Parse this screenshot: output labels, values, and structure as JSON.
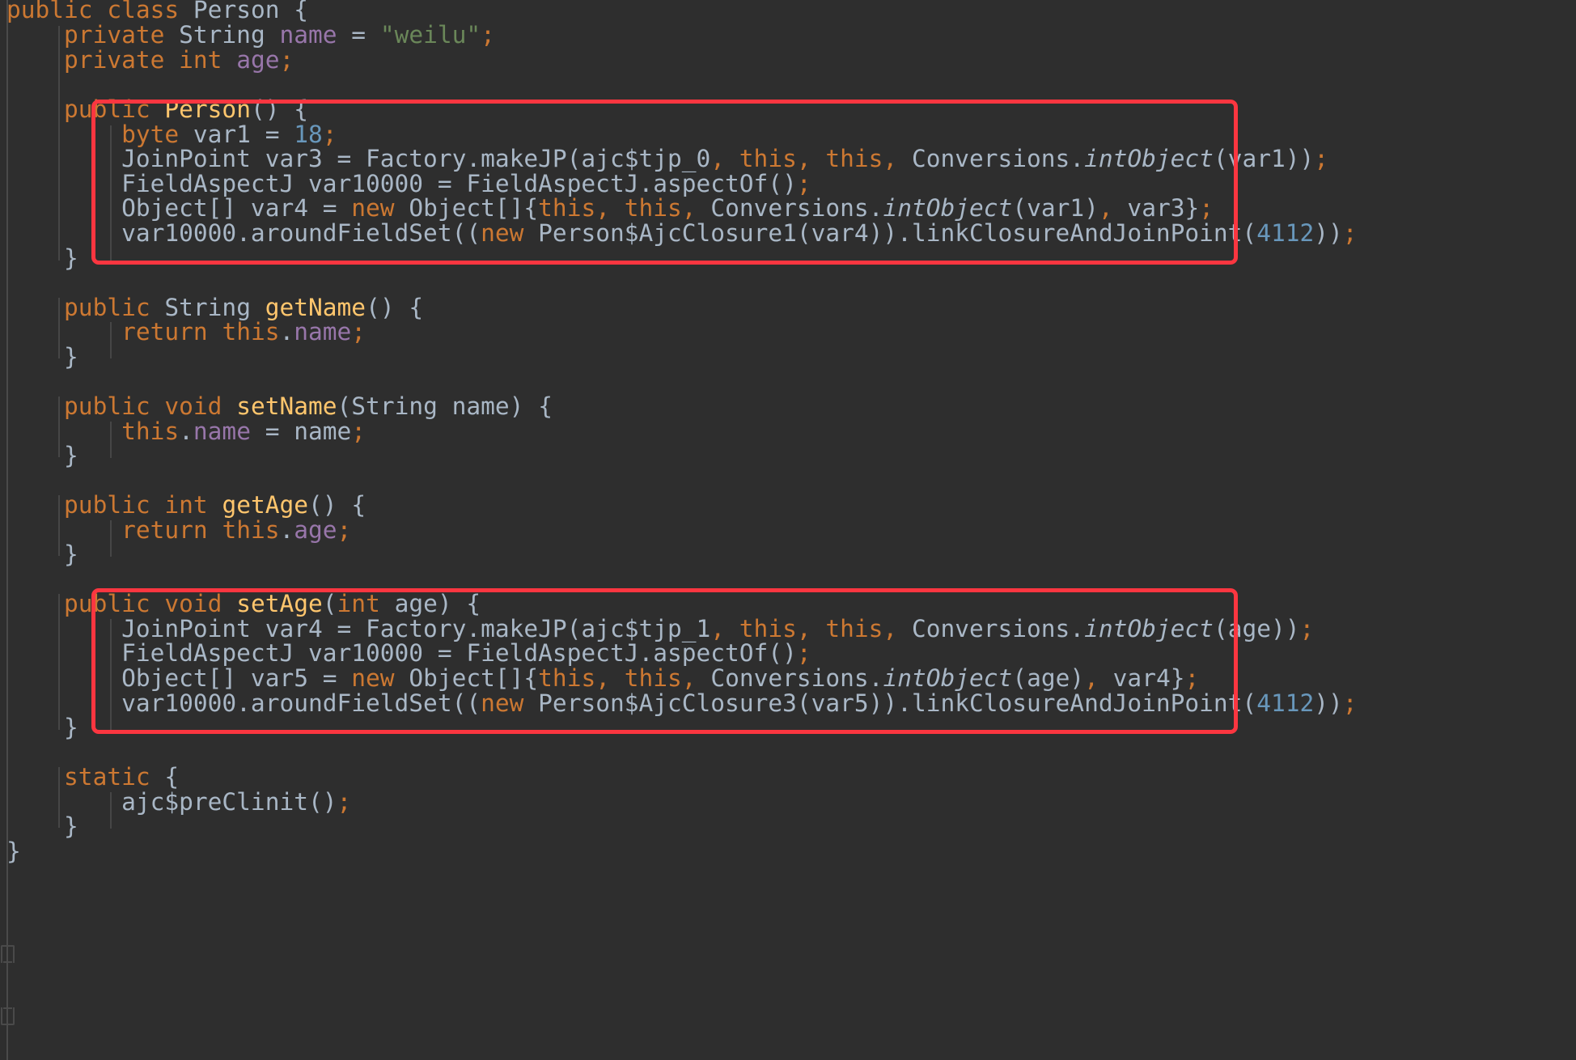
{
  "editor": {
    "language": "java",
    "theme": "darcula",
    "background_color": "#2e2e2e",
    "default_text_color": "#a9b7c6",
    "colors": {
      "keyword": "#cc7832",
      "method_declaration": "#ffc66d",
      "field": "#9876aa",
      "string": "#6a8759",
      "number": "#6897bb",
      "identifier": "#a9b7c6",
      "annotation_box": "#fb3640",
      "indent_guide": "#464646",
      "gutter_line": "#4a4a4a"
    },
    "font_size_px": 29.5,
    "line_height_px": 30.6
  },
  "annotations": {
    "box_1_label": "constructor-weaving-highlight",
    "box_2_label": "setter-weaving-highlight"
  },
  "code_lines": [
    {
      "n": 1,
      "indent": 0,
      "text": "public class Person {"
    },
    {
      "n": 2,
      "indent": 1,
      "text": "private String name = \"weilu\";"
    },
    {
      "n": 3,
      "indent": 1,
      "text": "private int age;"
    },
    {
      "n": 4,
      "indent": 0,
      "text": ""
    },
    {
      "n": 5,
      "indent": 1,
      "text": "public Person() {"
    },
    {
      "n": 6,
      "indent": 2,
      "text": "byte var1 = 18;"
    },
    {
      "n": 7,
      "indent": 2,
      "text": "JoinPoint var3 = Factory.makeJP(ajc$tjp_0, this, this, Conversions.intObject(var1));"
    },
    {
      "n": 8,
      "indent": 2,
      "text": "FieldAspectJ var10000 = FieldAspectJ.aspectOf();"
    },
    {
      "n": 9,
      "indent": 2,
      "text": "Object[] var4 = new Object[]{this, this, Conversions.intObject(var1), var3};"
    },
    {
      "n": 10,
      "indent": 2,
      "text": "var10000.aroundFieldSet((new Person$AjcClosure1(var4)).linkClosureAndJoinPoint(4112));"
    },
    {
      "n": 11,
      "indent": 1,
      "text": "}"
    },
    {
      "n": 12,
      "indent": 0,
      "text": ""
    },
    {
      "n": 13,
      "indent": 1,
      "text": "public String getName() {"
    },
    {
      "n": 14,
      "indent": 2,
      "text": "return this.name;"
    },
    {
      "n": 15,
      "indent": 1,
      "text": "}"
    },
    {
      "n": 16,
      "indent": 0,
      "text": ""
    },
    {
      "n": 17,
      "indent": 1,
      "text": "public void setName(String name) {"
    },
    {
      "n": 18,
      "indent": 2,
      "text": "this.name = name;"
    },
    {
      "n": 19,
      "indent": 1,
      "text": "}"
    },
    {
      "n": 20,
      "indent": 0,
      "text": ""
    },
    {
      "n": 21,
      "indent": 1,
      "text": "public int getAge() {"
    },
    {
      "n": 22,
      "indent": 2,
      "text": "return this.age;"
    },
    {
      "n": 23,
      "indent": 1,
      "text": "}"
    },
    {
      "n": 24,
      "indent": 0,
      "text": ""
    },
    {
      "n": 25,
      "indent": 1,
      "text": "public void setAge(int age) {"
    },
    {
      "n": 26,
      "indent": 2,
      "text": "JoinPoint var4 = Factory.makeJP(ajc$tjp_1, this, this, Conversions.intObject(age));"
    },
    {
      "n": 27,
      "indent": 2,
      "text": "FieldAspectJ var10000 = FieldAspectJ.aspectOf();"
    },
    {
      "n": 28,
      "indent": 2,
      "text": "Object[] var5 = new Object[]{this, this, Conversions.intObject(age), var4};"
    },
    {
      "n": 29,
      "indent": 2,
      "text": "var10000.aroundFieldSet((new Person$AjcClosure3(var5)).linkClosureAndJoinPoint(4112));"
    },
    {
      "n": 30,
      "indent": 1,
      "text": "}"
    },
    {
      "n": 31,
      "indent": 0,
      "text": ""
    },
    {
      "n": 32,
      "indent": 1,
      "text": "static {"
    },
    {
      "n": 33,
      "indent": 2,
      "text": "ajc$preClinit();"
    },
    {
      "n": 34,
      "indent": 1,
      "text": "}"
    },
    {
      "n": 35,
      "indent": 0,
      "text": "}"
    }
  ],
  "tokens": {
    "l1": [
      {
        "t": "public",
        "c": "kw"
      },
      {
        "t": " ",
        "c": "pun"
      },
      {
        "t": "class",
        "c": "kw"
      },
      {
        "t": " ",
        "c": "pun"
      },
      {
        "t": "Person",
        "c": "cls"
      },
      {
        "t": " {",
        "c": "pun"
      }
    ],
    "l2": [
      {
        "t": "    ",
        "c": "pun"
      },
      {
        "t": "private",
        "c": "kw"
      },
      {
        "t": " ",
        "c": "pun"
      },
      {
        "t": "String",
        "c": "cls"
      },
      {
        "t": " ",
        "c": "pun"
      },
      {
        "t": "name",
        "c": "fld"
      },
      {
        "t": " = ",
        "c": "pun"
      },
      {
        "t": "\"weilu\"",
        "c": "str"
      },
      {
        "t": ";",
        "c": "semi"
      }
    ],
    "l3": [
      {
        "t": "    ",
        "c": "pun"
      },
      {
        "t": "private",
        "c": "kw"
      },
      {
        "t": " ",
        "c": "pun"
      },
      {
        "t": "int",
        "c": "kw"
      },
      {
        "t": " ",
        "c": "pun"
      },
      {
        "t": "age",
        "c": "fld"
      },
      {
        "t": ";",
        "c": "semi"
      }
    ],
    "l5": [
      {
        "t": "    ",
        "c": "pun"
      },
      {
        "t": "public",
        "c": "kw"
      },
      {
        "t": " ",
        "c": "pun"
      },
      {
        "t": "Person",
        "c": "mth"
      },
      {
        "t": "() {",
        "c": "pun"
      }
    ],
    "l6": [
      {
        "t": "        ",
        "c": "pun"
      },
      {
        "t": "byte",
        "c": "kw"
      },
      {
        "t": " var1 = ",
        "c": "pun"
      },
      {
        "t": "18",
        "c": "num"
      },
      {
        "t": ";",
        "c": "semi"
      }
    ],
    "l7": [
      {
        "t": "        JoinPoint var3 = Factory.makeJP(ajc$tjp_0",
        "c": "cls"
      },
      {
        "t": ",",
        "c": "semi"
      },
      {
        "t": " ",
        "c": "pun"
      },
      {
        "t": "this",
        "c": "kw"
      },
      {
        "t": ",",
        "c": "semi"
      },
      {
        "t": " ",
        "c": "pun"
      },
      {
        "t": "this",
        "c": "kw"
      },
      {
        "t": ",",
        "c": "semi"
      },
      {
        "t": " ",
        "c": "pun"
      },
      {
        "t": "Conversions.",
        "c": "cls"
      },
      {
        "t": "intObject",
        "c": "stat"
      },
      {
        "t": "(var1))",
        "c": "cls"
      },
      {
        "t": ";",
        "c": "semi"
      }
    ],
    "l8": [
      {
        "t": "        FieldAspectJ var10000 = FieldAspectJ.aspectOf()",
        "c": "cls"
      },
      {
        "t": ";",
        "c": "semi"
      }
    ],
    "l9": [
      {
        "t": "        Object[] var4 = ",
        "c": "cls"
      },
      {
        "t": "new",
        "c": "kw"
      },
      {
        "t": " Object[]{",
        "c": "cls"
      },
      {
        "t": "this",
        "c": "kw"
      },
      {
        "t": ",",
        "c": "semi"
      },
      {
        "t": " ",
        "c": "pun"
      },
      {
        "t": "this",
        "c": "kw"
      },
      {
        "t": ",",
        "c": "semi"
      },
      {
        "t": " ",
        "c": "pun"
      },
      {
        "t": "Conversions.",
        "c": "cls"
      },
      {
        "t": "intObject",
        "c": "stat"
      },
      {
        "t": "(var1)",
        "c": "cls"
      },
      {
        "t": ",",
        "c": "semi"
      },
      {
        "t": " var3}",
        "c": "cls"
      },
      {
        "t": ";",
        "c": "semi"
      }
    ],
    "l10": [
      {
        "t": "        var10000.aroundFieldSet((",
        "c": "cls"
      },
      {
        "t": "new",
        "c": "kw"
      },
      {
        "t": " Person$AjcClosure1(var4)).linkClosureAndJoinPoint(",
        "c": "cls"
      },
      {
        "t": "4112",
        "c": "num"
      },
      {
        "t": "))",
        "c": "cls"
      },
      {
        "t": ";",
        "c": "semi"
      }
    ],
    "l11": [
      {
        "t": "    }",
        "c": "pun"
      }
    ],
    "l13": [
      {
        "t": "    ",
        "c": "pun"
      },
      {
        "t": "public",
        "c": "kw"
      },
      {
        "t": " ",
        "c": "pun"
      },
      {
        "t": "String",
        "c": "cls"
      },
      {
        "t": " ",
        "c": "pun"
      },
      {
        "t": "getName",
        "c": "mth"
      },
      {
        "t": "() {",
        "c": "pun"
      }
    ],
    "l14": [
      {
        "t": "        ",
        "c": "pun"
      },
      {
        "t": "return",
        "c": "kw"
      },
      {
        "t": " ",
        "c": "pun"
      },
      {
        "t": "this",
        "c": "kw"
      },
      {
        "t": ".",
        "c": "pun"
      },
      {
        "t": "name",
        "c": "fld"
      },
      {
        "t": ";",
        "c": "semi"
      }
    ],
    "l15": [
      {
        "t": "    }",
        "c": "pun"
      }
    ],
    "l17": [
      {
        "t": "    ",
        "c": "pun"
      },
      {
        "t": "public",
        "c": "kw"
      },
      {
        "t": " ",
        "c": "pun"
      },
      {
        "t": "void",
        "c": "kw"
      },
      {
        "t": " ",
        "c": "pun"
      },
      {
        "t": "setName",
        "c": "mth"
      },
      {
        "t": "(",
        "c": "pun"
      },
      {
        "t": "String",
        "c": "cls"
      },
      {
        "t": " name) {",
        "c": "pun"
      }
    ],
    "l18": [
      {
        "t": "        ",
        "c": "pun"
      },
      {
        "t": "this",
        "c": "kw"
      },
      {
        "t": ".",
        "c": "pun"
      },
      {
        "t": "name",
        "c": "fld"
      },
      {
        "t": " = name",
        "c": "cls"
      },
      {
        "t": ";",
        "c": "semi"
      }
    ],
    "l19": [
      {
        "t": "    }",
        "c": "pun"
      }
    ],
    "l21": [
      {
        "t": "    ",
        "c": "pun"
      },
      {
        "t": "public",
        "c": "kw"
      },
      {
        "t": " ",
        "c": "pun"
      },
      {
        "t": "int",
        "c": "kw"
      },
      {
        "t": " ",
        "c": "pun"
      },
      {
        "t": "getAge",
        "c": "mth"
      },
      {
        "t": "() {",
        "c": "pun"
      }
    ],
    "l22": [
      {
        "t": "        ",
        "c": "pun"
      },
      {
        "t": "return",
        "c": "kw"
      },
      {
        "t": " ",
        "c": "pun"
      },
      {
        "t": "this",
        "c": "kw"
      },
      {
        "t": ".",
        "c": "pun"
      },
      {
        "t": "age",
        "c": "fld"
      },
      {
        "t": ";",
        "c": "semi"
      }
    ],
    "l23": [
      {
        "t": "    }",
        "c": "pun"
      }
    ],
    "l25": [
      {
        "t": "    ",
        "c": "pun"
      },
      {
        "t": "public",
        "c": "kw"
      },
      {
        "t": " ",
        "c": "pun"
      },
      {
        "t": "void",
        "c": "kw"
      },
      {
        "t": " ",
        "c": "pun"
      },
      {
        "t": "setAge",
        "c": "mth"
      },
      {
        "t": "(",
        "c": "pun"
      },
      {
        "t": "int",
        "c": "kw"
      },
      {
        "t": " age) {",
        "c": "pun"
      }
    ],
    "l26": [
      {
        "t": "        JoinPoint var4 = Factory.makeJP(ajc$tjp_1",
        "c": "cls"
      },
      {
        "t": ",",
        "c": "semi"
      },
      {
        "t": " ",
        "c": "pun"
      },
      {
        "t": "this",
        "c": "kw"
      },
      {
        "t": ",",
        "c": "semi"
      },
      {
        "t": " ",
        "c": "pun"
      },
      {
        "t": "this",
        "c": "kw"
      },
      {
        "t": ",",
        "c": "semi"
      },
      {
        "t": " ",
        "c": "pun"
      },
      {
        "t": "Conversions.",
        "c": "cls"
      },
      {
        "t": "intObject",
        "c": "stat"
      },
      {
        "t": "(age))",
        "c": "cls"
      },
      {
        "t": ";",
        "c": "semi"
      }
    ],
    "l27": [
      {
        "t": "        FieldAspectJ var10000 = FieldAspectJ.aspectOf()",
        "c": "cls"
      },
      {
        "t": ";",
        "c": "semi"
      }
    ],
    "l28": [
      {
        "t": "        Object[] var5 = ",
        "c": "cls"
      },
      {
        "t": "new",
        "c": "kw"
      },
      {
        "t": " Object[]{",
        "c": "cls"
      },
      {
        "t": "this",
        "c": "kw"
      },
      {
        "t": ",",
        "c": "semi"
      },
      {
        "t": " ",
        "c": "pun"
      },
      {
        "t": "this",
        "c": "kw"
      },
      {
        "t": ",",
        "c": "semi"
      },
      {
        "t": " ",
        "c": "pun"
      },
      {
        "t": "Conversions.",
        "c": "cls"
      },
      {
        "t": "intObject",
        "c": "stat"
      },
      {
        "t": "(age)",
        "c": "cls"
      },
      {
        "t": ",",
        "c": "semi"
      },
      {
        "t": " var4}",
        "c": "cls"
      },
      {
        "t": ";",
        "c": "semi"
      }
    ],
    "l29": [
      {
        "t": "        var10000.aroundFieldSet((",
        "c": "cls"
      },
      {
        "t": "new",
        "c": "kw"
      },
      {
        "t": " Person$AjcClosure3(var5)).linkClosureAndJoinPoint(",
        "c": "cls"
      },
      {
        "t": "4112",
        "c": "num"
      },
      {
        "t": "))",
        "c": "cls"
      },
      {
        "t": ";",
        "c": "semi"
      }
    ],
    "l30": [
      {
        "t": "    }",
        "c": "pun"
      }
    ],
    "l32": [
      {
        "t": "    ",
        "c": "pun"
      },
      {
        "t": "static",
        "c": "kw"
      },
      {
        "t": " {",
        "c": "pun"
      }
    ],
    "l33": [
      {
        "t": "        ajc$preClinit()",
        "c": "cls"
      },
      {
        "t": ";",
        "c": "semi"
      }
    ],
    "l34": [
      {
        "t": "    }",
        "c": "pun"
      }
    ],
    "l35": [
      {
        "t": "}",
        "c": "pun"
      }
    ]
  }
}
